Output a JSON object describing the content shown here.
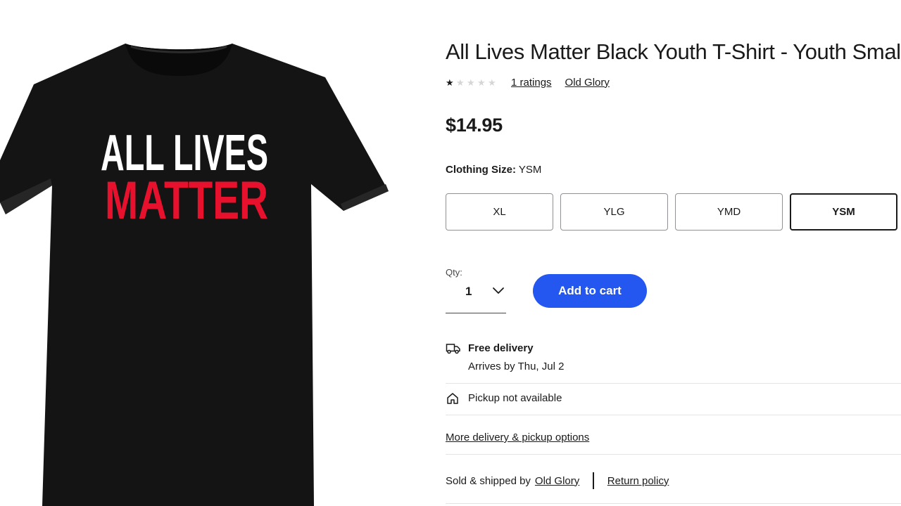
{
  "product": {
    "title": "All Lives Matter Black Youth T-Shirt - Youth Small",
    "image": {
      "print_line1": "ALL LIVES",
      "print_line2": "MATTER",
      "shirt_color": "#141414",
      "print_color_top": "#ffffff",
      "print_color_bottom": "#e8112d"
    },
    "rating": {
      "stars": 1,
      "max_stars": 5,
      "ratings_link": "1 ratings"
    },
    "brand_link": "Old Glory",
    "price": "$14.95"
  },
  "size": {
    "label": "Clothing Size:",
    "selected_value": "YSM",
    "options": [
      "XL",
      "YLG",
      "YMD",
      "YSM"
    ]
  },
  "quantity": {
    "label": "Qty:",
    "value": "1",
    "icon": "chevron-down-icon"
  },
  "cart": {
    "add_label": "Add to cart",
    "button_color": "#2456f0"
  },
  "fulfillment": {
    "delivery_icon": "truck-icon",
    "delivery_title": "Free delivery",
    "delivery_sub": "Arrives by Thu, Jul 2",
    "pickup_icon": "home-icon",
    "pickup_text": "Pickup not available",
    "more_options_link": "More delivery & pickup options"
  },
  "seller": {
    "sold_by_text": "Sold & shipped by",
    "seller_link": "Old Glory",
    "return_policy_link": "Return policy"
  }
}
